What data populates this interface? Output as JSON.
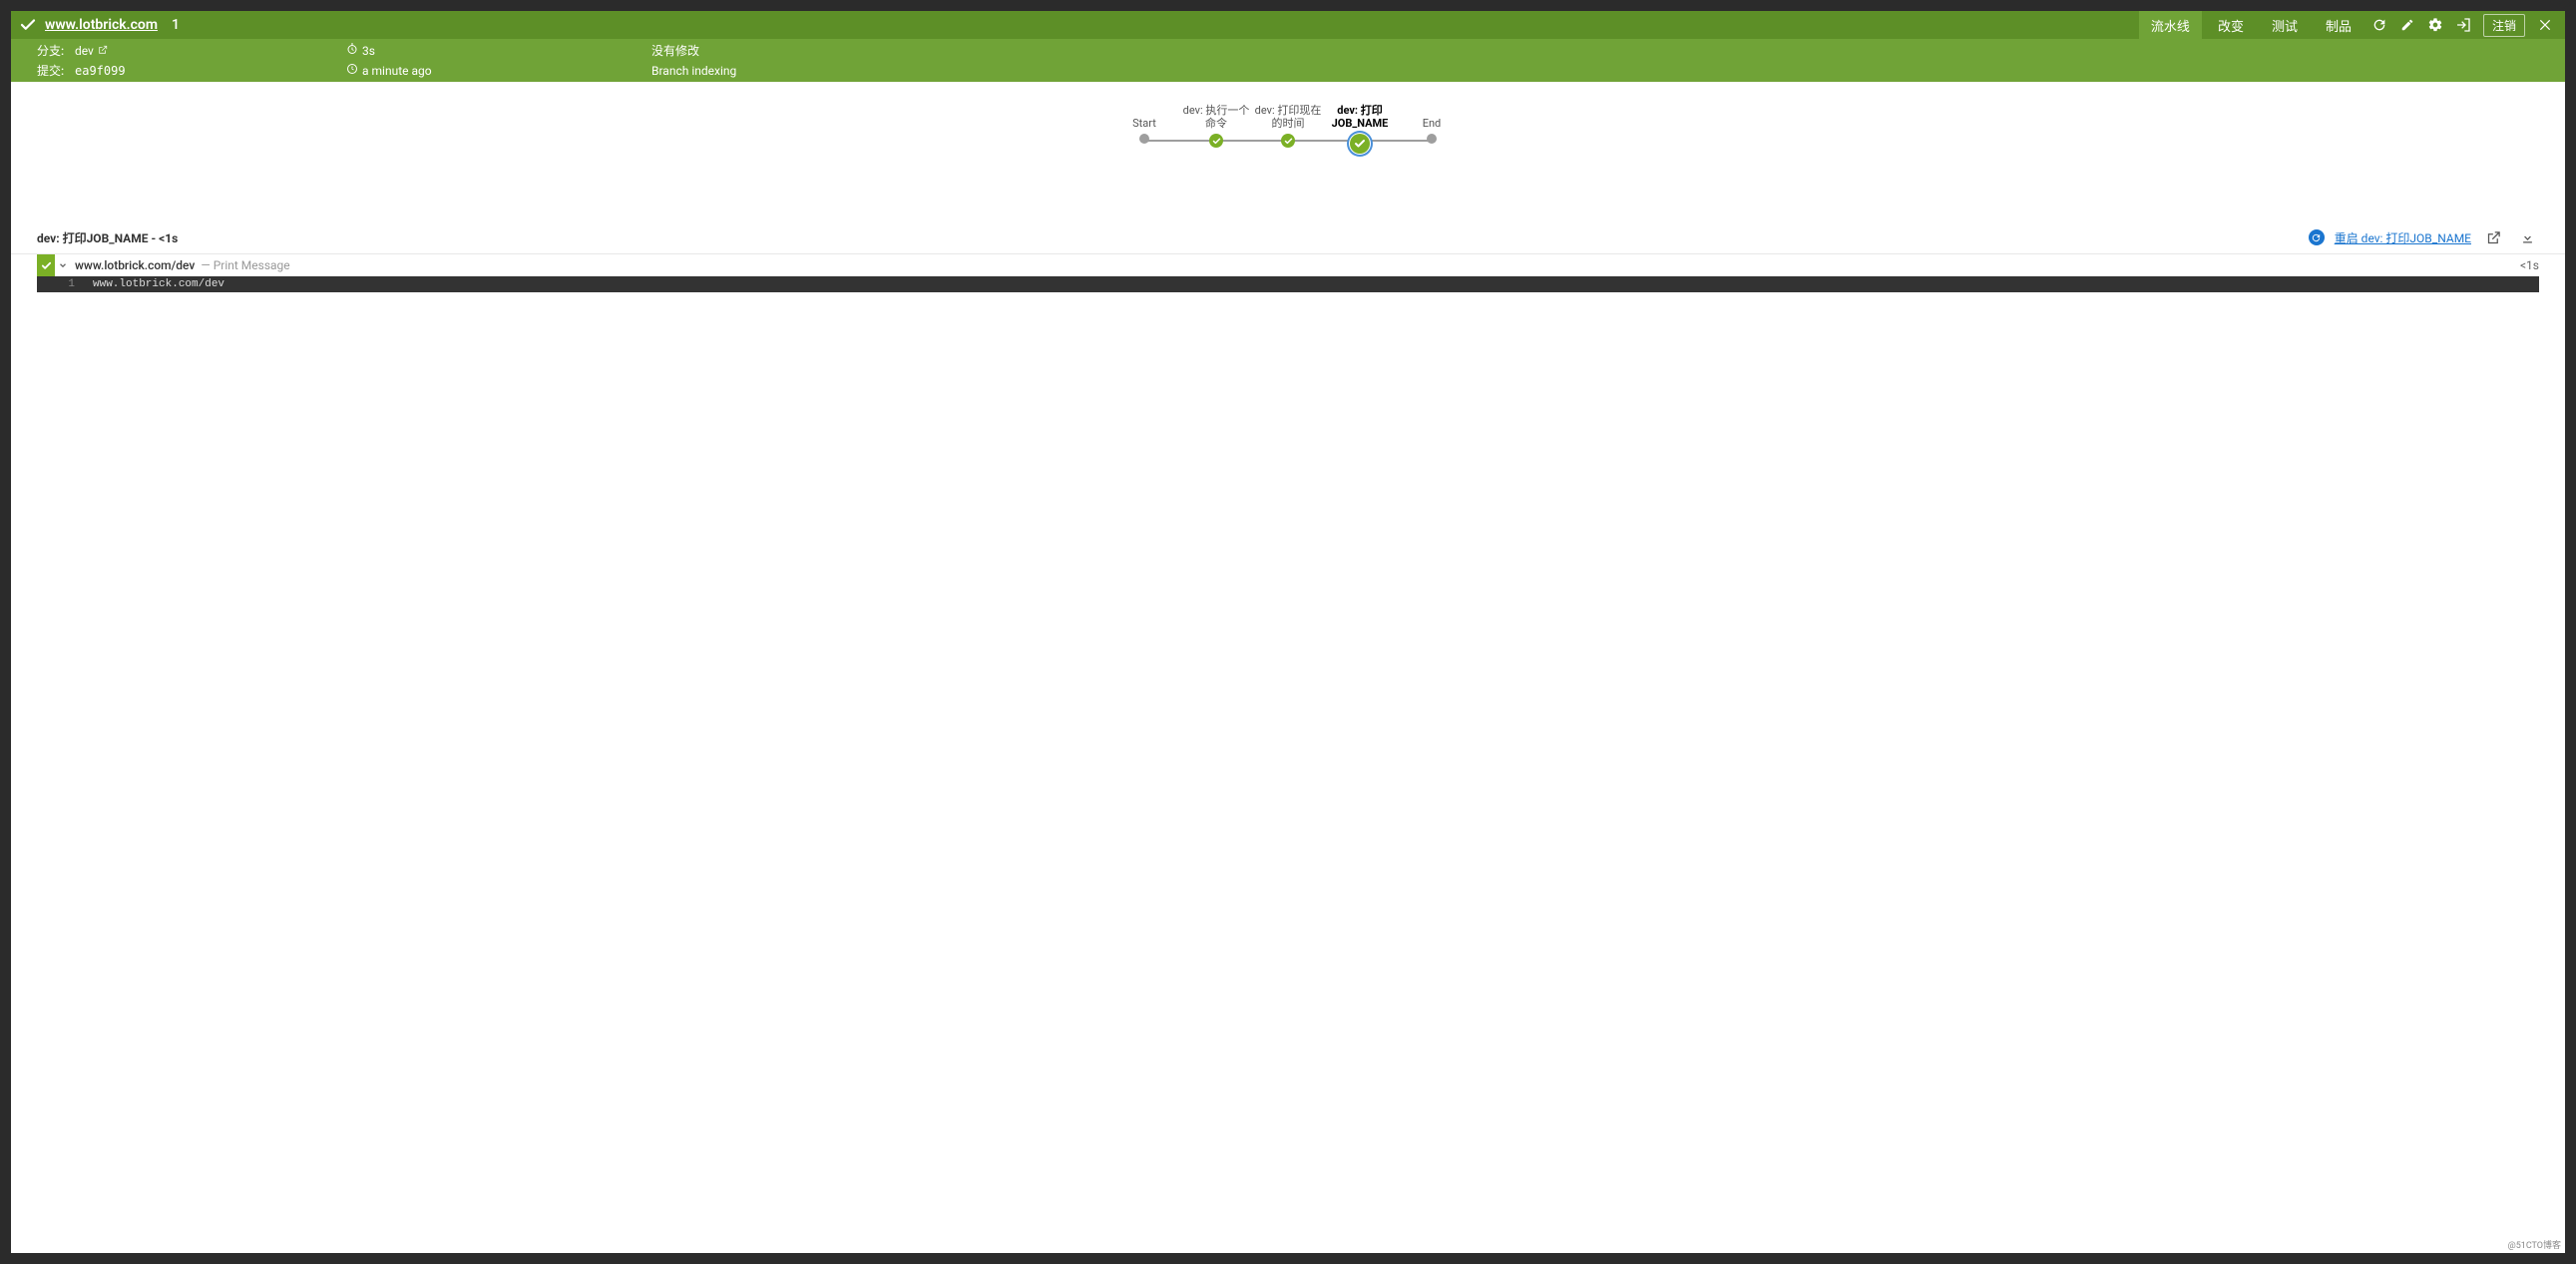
{
  "header": {
    "breadcrumb": "www.lotbrick.com",
    "run_number": "1",
    "tabs": {
      "pipeline": "流水线",
      "changes": "改变",
      "tests": "测试",
      "artifacts": "制品"
    },
    "logout_label": "注销"
  },
  "subheader": {
    "branch_label": "分支:",
    "branch_value": "dev",
    "commit_label": "提交:",
    "commit_value": "ea9f099",
    "duration": "3s",
    "time_ago": "a minute ago",
    "changes": "没有修改",
    "cause": "Branch indexing"
  },
  "pipeline": {
    "stages": [
      {
        "label": "Start",
        "type": "dot"
      },
      {
        "label": "dev: 执行一个命令",
        "type": "success"
      },
      {
        "label": "dev: 打印现在的时间",
        "type": "success"
      },
      {
        "label": "dev: 打印JOB_NAME",
        "type": "success",
        "selected": true
      },
      {
        "label": "End",
        "type": "dot"
      }
    ]
  },
  "stage_info": {
    "title": "dev: 打印JOB_NAME - <1s",
    "restart_label": "重启 dev: 打印JOB_NAME"
  },
  "step": {
    "name": "www.lotbrick.com/dev",
    "desc": "— Print Message",
    "duration": "<1s"
  },
  "console": {
    "line_no": "1",
    "text": "www.lotbrick.com/dev"
  },
  "watermark": "@51CTO博客"
}
